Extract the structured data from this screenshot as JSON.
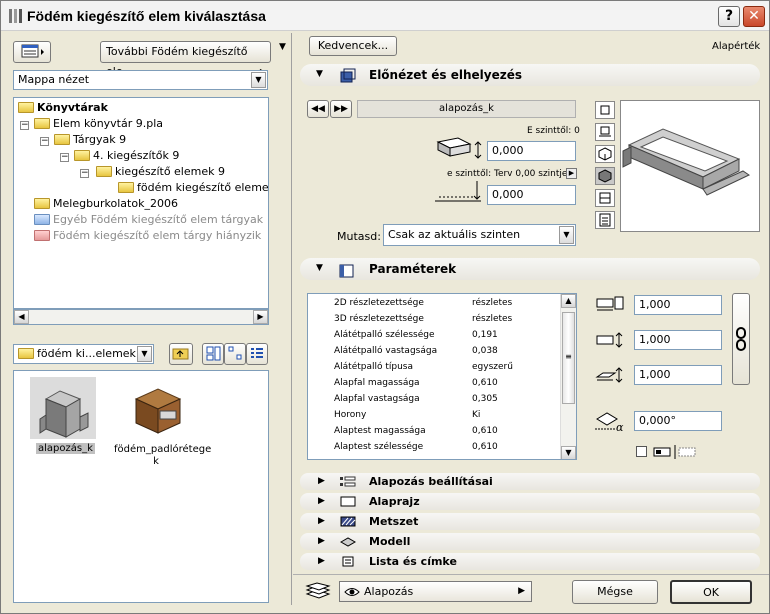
{
  "window": {
    "title": "Födém kiegészítő elem kiválasztása",
    "help_label": "?",
    "close_label": "✕"
  },
  "left": {
    "more_button": "További Födém kiegészítő ele...",
    "view_mode": "Mappa nézet",
    "tree": [
      {
        "label": "Könyvtárak",
        "bold": true
      },
      {
        "label": "Elem könyvtár 9.pla"
      },
      {
        "label": "Tárgyak 9"
      },
      {
        "label": "4. kiegészítők 9"
      },
      {
        "label": "kiegészítő elemek 9"
      },
      {
        "label": "födém kiegészítő elemek 9"
      },
      {
        "label": "Melegburkolatok_2006"
      },
      {
        "label": "Egyéb Födém kiegészítő elem tárgyak",
        "gray": true
      },
      {
        "label": "Födém kiegészítő elem tárgy hiányzik",
        "gray": true
      }
    ],
    "folder_path": "födém ki...elemek 9",
    "items": [
      {
        "label": "alapozás_k",
        "selected": true
      },
      {
        "label": "födém_padlórétege k"
      }
    ]
  },
  "right": {
    "favorites_button": "Kedvencek...",
    "default_label": "Alapérték",
    "preview_section": {
      "title": "Előnézet és elhelyezés",
      "element_name": "alapozás_k",
      "top_label": "E szinttől: 0",
      "top_value": "0,000",
      "story_label": "e szinttől: Terv 0,00 szintje",
      "bottom_value": "0,000",
      "show_label": "Mutasd:",
      "show_value": "Csak az aktuális szinten"
    },
    "params_section": {
      "title": "Paraméterek",
      "rows": [
        {
          "name": "2D részletezettsége",
          "value": "részletes"
        },
        {
          "name": "3D részletezettsége",
          "value": "részletes"
        },
        {
          "name": "Alátétpalló szélessége",
          "value": "0,191"
        },
        {
          "name": "Alátétpalló vastagsága",
          "value": "0,038"
        },
        {
          "name": "Alátétpalló típusa",
          "value": "egyszerű"
        },
        {
          "name": "Alapfal magassága",
          "value": "0,610"
        },
        {
          "name": "Alapfal vastagsága",
          "value": "0,305"
        },
        {
          "name": "Horony",
          "value": "Ki"
        },
        {
          "name": "Alaptest magassága",
          "value": "0,610"
        },
        {
          "name": "Alaptest szélessége",
          "value": "0,610"
        }
      ],
      "size_x": "1,000",
      "size_y": "1,000",
      "size_z": "1,000",
      "angle": "0,000°"
    },
    "collapsed_sections": [
      "Alapozás beállításai",
      "Alaprajz",
      "Metszet",
      "Modell",
      "Lista és címke"
    ],
    "layer_value": "Alapozás",
    "cancel_button": "Mégse",
    "ok_button": "OK"
  }
}
